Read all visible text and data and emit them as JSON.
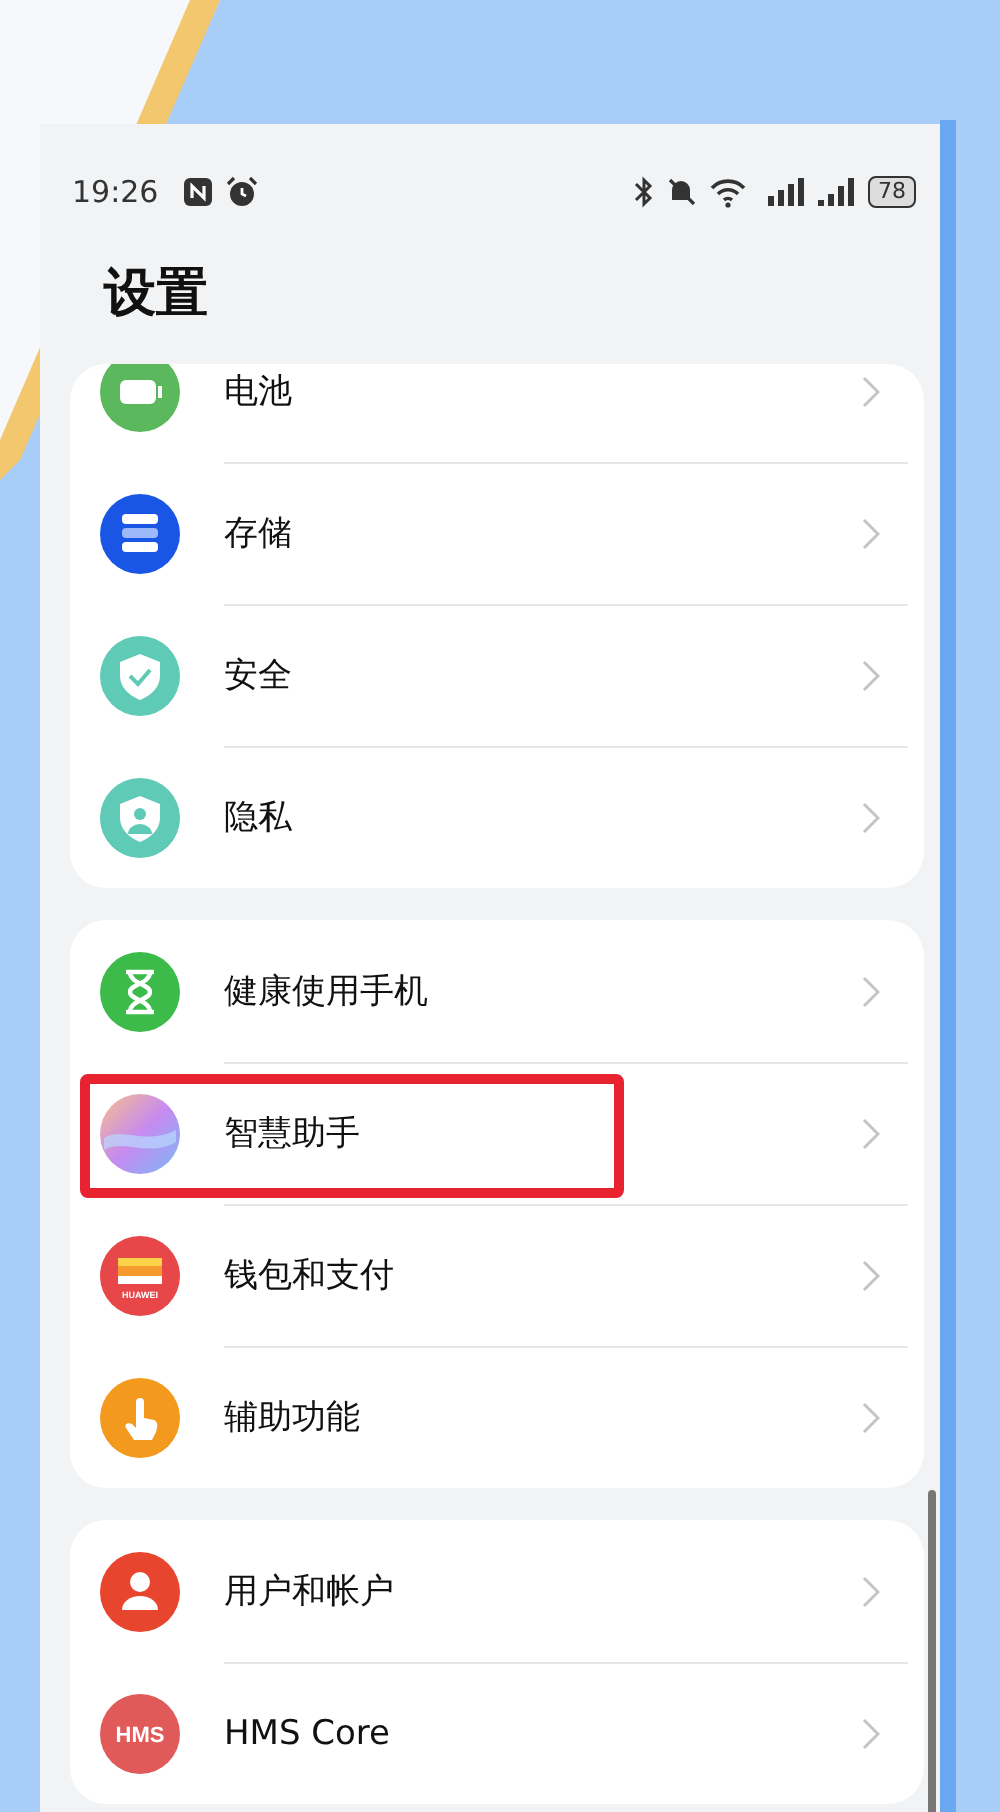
{
  "status_bar": {
    "time": "19:26",
    "battery": "78"
  },
  "title": "设置",
  "groups": [
    {
      "items": [
        {
          "label": "电池",
          "kind": "battery",
          "highlighted": false
        },
        {
          "label": "存储",
          "kind": "storage",
          "highlighted": false
        },
        {
          "label": "安全",
          "kind": "security",
          "highlighted": false
        },
        {
          "label": "隐私",
          "kind": "privacy",
          "highlighted": false
        }
      ]
    },
    {
      "items": [
        {
          "label": "健康使用手机",
          "kind": "hourglass",
          "highlighted": false
        },
        {
          "label": "智慧助手",
          "kind": "orb",
          "highlighted": true
        },
        {
          "label": "钱包和支付",
          "kind": "wallet",
          "icon_text": "HUAWEI",
          "highlighted": false
        },
        {
          "label": "辅助功能",
          "kind": "hand",
          "highlighted": false
        }
      ]
    },
    {
      "items": [
        {
          "label": "用户和帐户",
          "kind": "user",
          "highlighted": false
        },
        {
          "label": "HMS Core",
          "kind": "hms",
          "icon_text": "HMS",
          "highlighted": false
        }
      ]
    }
  ]
}
